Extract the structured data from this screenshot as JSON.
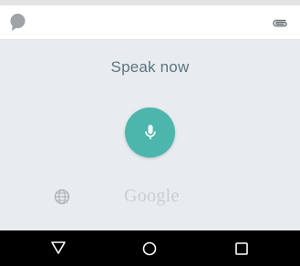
{
  "top_bar": {
    "left_icon": "speech-bubble-icon",
    "right_icon": "paperclip-icon"
  },
  "voice": {
    "prompt": "Speak now",
    "mic_icon": "microphone-icon",
    "language_icon": "globe-icon",
    "logo_text": "Google",
    "accent_color": "#4db6ac"
  },
  "nav_bar": {
    "back_icon": "back-triangle-icon",
    "home_icon": "home-circle-icon",
    "recents_icon": "recents-square-icon"
  }
}
